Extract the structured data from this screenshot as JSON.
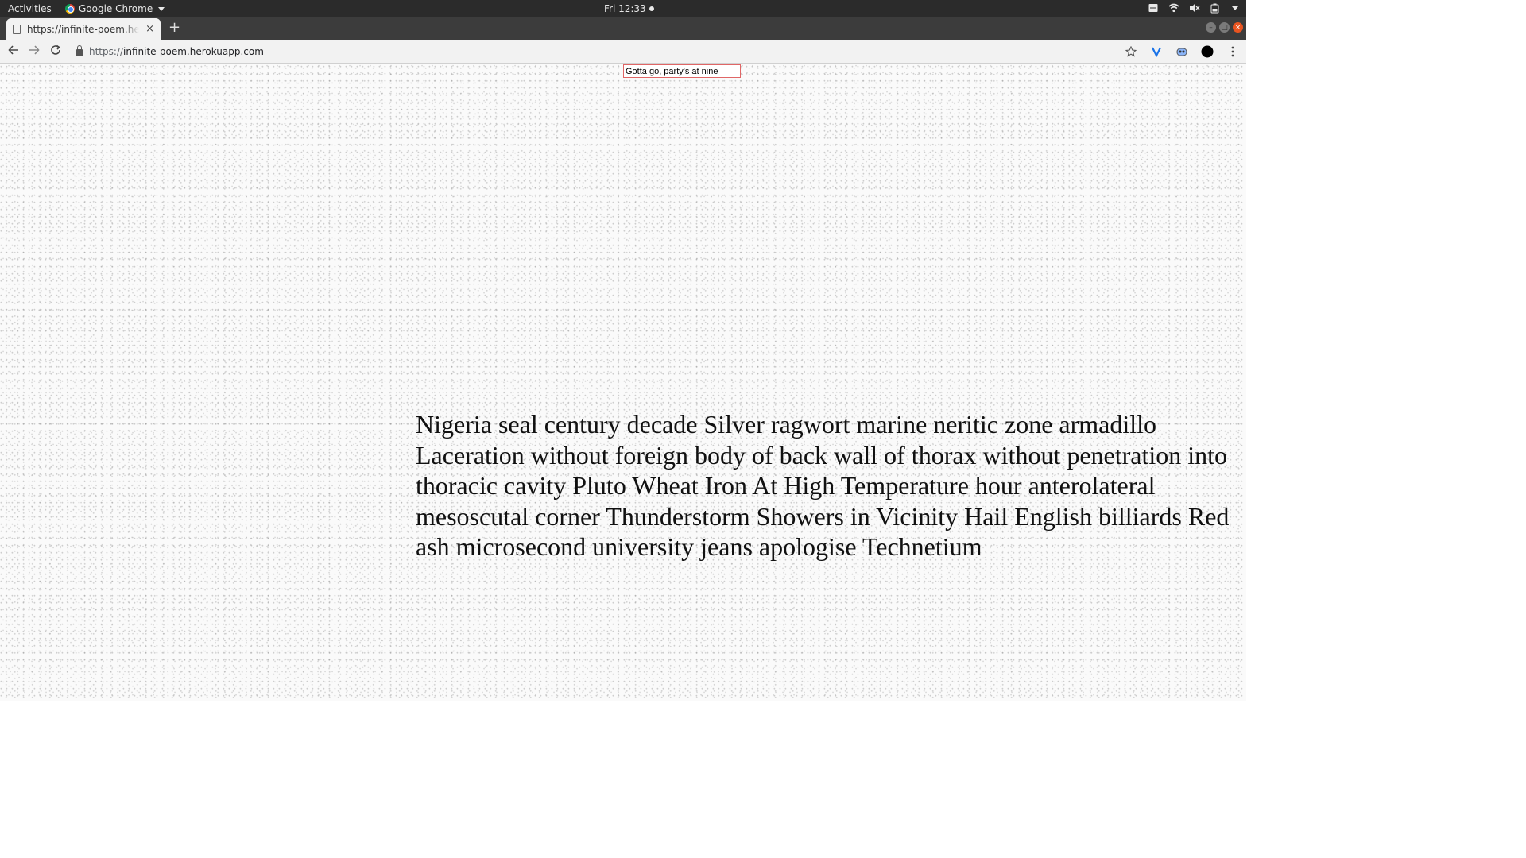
{
  "system_bar": {
    "activities": "Activities",
    "app_name": "Google Chrome",
    "clock": "Fri 12:33"
  },
  "browser": {
    "tab_title": "https://infinite-poem.herokuapp.com",
    "tab_close": "×",
    "new_tab": "+",
    "url_scheme": "https://",
    "url_host": "infinite-poem.herokuapp.com"
  },
  "page": {
    "input_value": "Gotta go, party's at nine",
    "poem_text": "Nigeria seal century decade Silver ragwort marine neritic zone armadillo Laceration without foreign body of back wall of thorax without penetration into thoracic cavity Pluto Wheat Iron At High Temperature hour anterolateral mesoscutal corner Thunderstorm Showers in Vicinity Hail English billiards Red ash microsecond university jeans apologise Technetium"
  },
  "icons": {
    "back": "arrow-left",
    "forward": "arrow-right",
    "reload": "reload",
    "bookmark": "star",
    "menu": "vertical-dots"
  },
  "colors": {
    "topbar": "#2b2b2b",
    "tabstrip": "#3c3c3c",
    "toolbar": "#f2f2f2",
    "input_border": "#e06666",
    "close_button": "#e95420"
  }
}
